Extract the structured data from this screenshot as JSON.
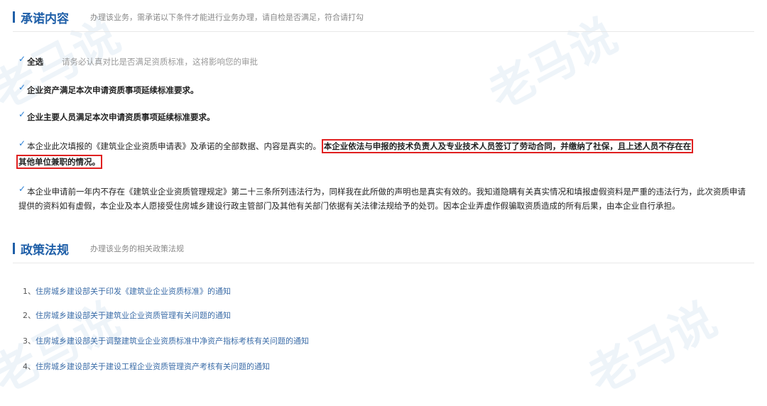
{
  "watermark": "老马说",
  "commitment": {
    "title": "承诺内容",
    "desc": "办理该业务，需承诺以下条件才能进行业务办理，请自检是否满足，符合请打勾",
    "select_all": "全选",
    "select_all_hint": "请务必认真对比是否满足资质标准，这将影响您的审批",
    "items": [
      "企业资产满足本次申请资质事项延续标准要求。",
      "企业主要人员满足本次申请资质事项延续标准要求。",
      "本企业此次填报的《建筑业企业资质申请表》及承诺的全部数据、内容是真实的。",
      "本企业依法与申报的技术负责人及专业技术人员签订了劳动合同，并缴纳了社保，且上述人员不存在在",
      "其他单位兼职的情况。",
      "本企业申请前一年内不存在《建筑业企业资质管理规定》第二十三条所列违法行为，同样我在此所做的声明也是真实有效的。我知道隐瞒有关真实情况和填报虚假资料是严重的违法行为，此次资质申请提供的资料如有虚假，本企业及本人愿接受住房城乡建设行政主管部门及其他有关部门依据有关法律法规给予的处罚。因本企业弄虚作假骗取资质造成的所有后果，由本企业自行承担。"
    ]
  },
  "policy": {
    "title": "政策法规",
    "desc": "办理该业务的相关政策法规",
    "links": [
      {
        "num": "1、",
        "text": "住房城乡建设部关于印发《建筑业企业资质标准》的通知"
      },
      {
        "num": "2、",
        "text": "住房城乡建设部关于建筑业企业资质管理有关问题的通知"
      },
      {
        "num": "3、",
        "text": "住房城乡建设部关于调整建筑业企业资质标准中净资产指标考核有关问题的通知"
      },
      {
        "num": "4、",
        "text": "住房城乡建设部关于建设工程企业资质管理资产考核有关问题的通知"
      }
    ]
  },
  "colors": {
    "accent": "#1f5fa8",
    "highlight": "#e02020",
    "check": "#2a7fd4"
  }
}
